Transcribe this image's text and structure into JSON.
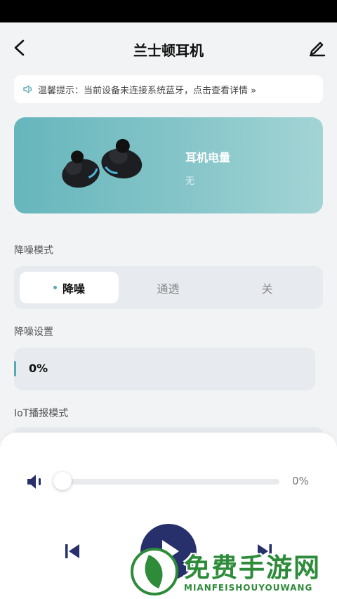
{
  "header": {
    "title": "兰士顿耳机",
    "back_icon": "back-arrow-icon",
    "edit_icon": "edit-pencil-icon"
  },
  "notice": {
    "icon": "speaker-icon",
    "text": "温馨提示：当前设备未连接系统蓝牙，点击查看详情 »"
  },
  "battery": {
    "title": "耳机电量",
    "value": "无"
  },
  "noise_mode": {
    "label": "降噪模式",
    "options": [
      "降噪",
      "通透",
      "关"
    ],
    "selected": "降噪"
  },
  "noise_setting": {
    "label": "降噪设置",
    "value": "0%",
    "level": 0
  },
  "iot": {
    "label": "IoT播报模式"
  },
  "player": {
    "volume_value": "0%",
    "volume_level": 0,
    "volume_icon": "volume-icon",
    "prev_icon": "skip-previous-icon",
    "play_icon": "play-icon",
    "next_icon": "skip-next-icon"
  },
  "watermark": {
    "title": "免费手游网",
    "subtitle": "MIANFEISHOUYOUWANG"
  },
  "colors": {
    "accent": "#5aa8b0",
    "play_button": "#27306b",
    "card_gradient_start": "#66b6bc",
    "card_gradient_end": "#a3d4d5",
    "watermark": "#2e8b3a"
  }
}
